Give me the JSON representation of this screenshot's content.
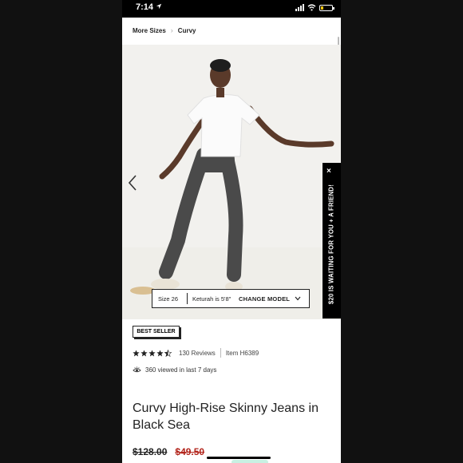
{
  "status_bar": {
    "time": "7:14"
  },
  "breadcrumb": {
    "items": [
      "More Sizes",
      "Curvy"
    ]
  },
  "model_info": {
    "size": "Size 26",
    "height": "Keturah is 5'8\"",
    "change_label": "CHANGE MODEL"
  },
  "promo": {
    "text": "$20 IS WAITING FOR YOU + A FRIEND!",
    "close": "×"
  },
  "product": {
    "badge": "BEST SELLER",
    "rating": 4.5,
    "reviews": "130 Reviews",
    "item_number": "Item H6389",
    "viewed": "360 viewed in last 7 days",
    "title": "Curvy High-Rise Skinny Jeans in Black Sea",
    "price_original": "$128.00",
    "price_sale": "$49.50"
  },
  "colors": {
    "sale_red": "#b2241b",
    "promo_bg": "#000000",
    "hero_bg": "#f2f1ee"
  }
}
